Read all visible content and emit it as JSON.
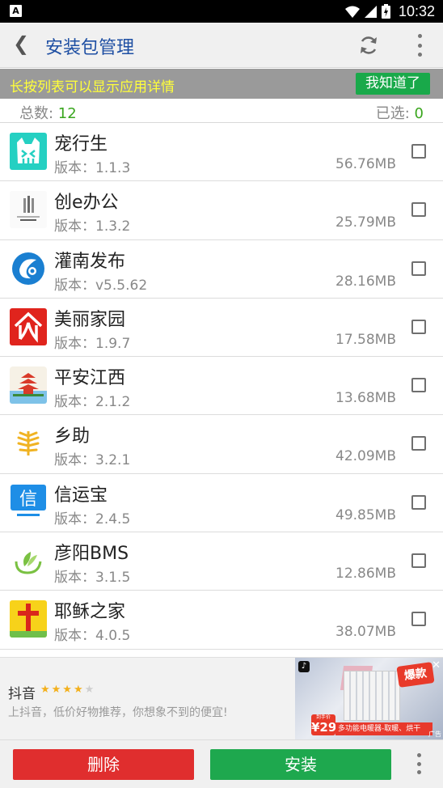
{
  "status_bar": {
    "time": "10:32",
    "left_badge": "A",
    "battery_glyph": "⚡"
  },
  "header": {
    "back_glyph": "❮",
    "title": "安装包管理",
    "refresh_icon": "refresh-icon",
    "more_icon": "more-vert-icon"
  },
  "tip": {
    "text": "长按列表可以显示应用详情",
    "button_label": "我知道了"
  },
  "counts": {
    "total_label": "总数: ",
    "total_value": "12",
    "selected_label": "已选: ",
    "selected_value": "0"
  },
  "apps": [
    {
      "name": "宠行生",
      "version": "版本：1.1.3",
      "size": "56.76MB",
      "checked": false
    },
    {
      "name": "创e办公",
      "version": "版本：1.3.2",
      "size": "25.79MB",
      "checked": false
    },
    {
      "name": "灌南发布",
      "version": "版本：v5.5.62",
      "size": "28.16MB",
      "checked": false
    },
    {
      "name": "美丽家园",
      "version": "版本：1.9.7",
      "size": "17.58MB",
      "checked": false
    },
    {
      "name": "平安江西",
      "version": "版本：2.1.2",
      "size": "13.68MB",
      "checked": false
    },
    {
      "name": "乡助",
      "version": "版本：3.2.1",
      "size": "42.09MB",
      "checked": false
    },
    {
      "name": "信运宝",
      "version": "版本：2.4.5",
      "size": "49.85MB",
      "checked": false
    },
    {
      "name": "彦阳BMS",
      "version": "版本：3.1.5",
      "size": "12.86MB",
      "checked": false
    },
    {
      "name": "耶稣之家",
      "version": "版本：4.0.5",
      "size": "38.07MB",
      "checked": false
    }
  ],
  "ad": {
    "title": "抖音",
    "rating_stars": 4,
    "description": "上抖音，低价好物推荐，你想象不到的便宜!",
    "hot_badge": "爆款",
    "price_prefix": "到手价",
    "price": "¥29",
    "caption": "多功能电暖器-取暖、烘干",
    "tag": "广告",
    "close_glyph": "✕"
  },
  "actions": {
    "delete_label": "删除",
    "install_label": "安装"
  },
  "colors": {
    "title_blue": "#1e4fa3",
    "tip_yellow": "#ffff3a",
    "ok_green": "#19a94a",
    "count_green": "#3aa61e",
    "delete_red": "#e02e2e",
    "install_green": "#1ea84e"
  }
}
